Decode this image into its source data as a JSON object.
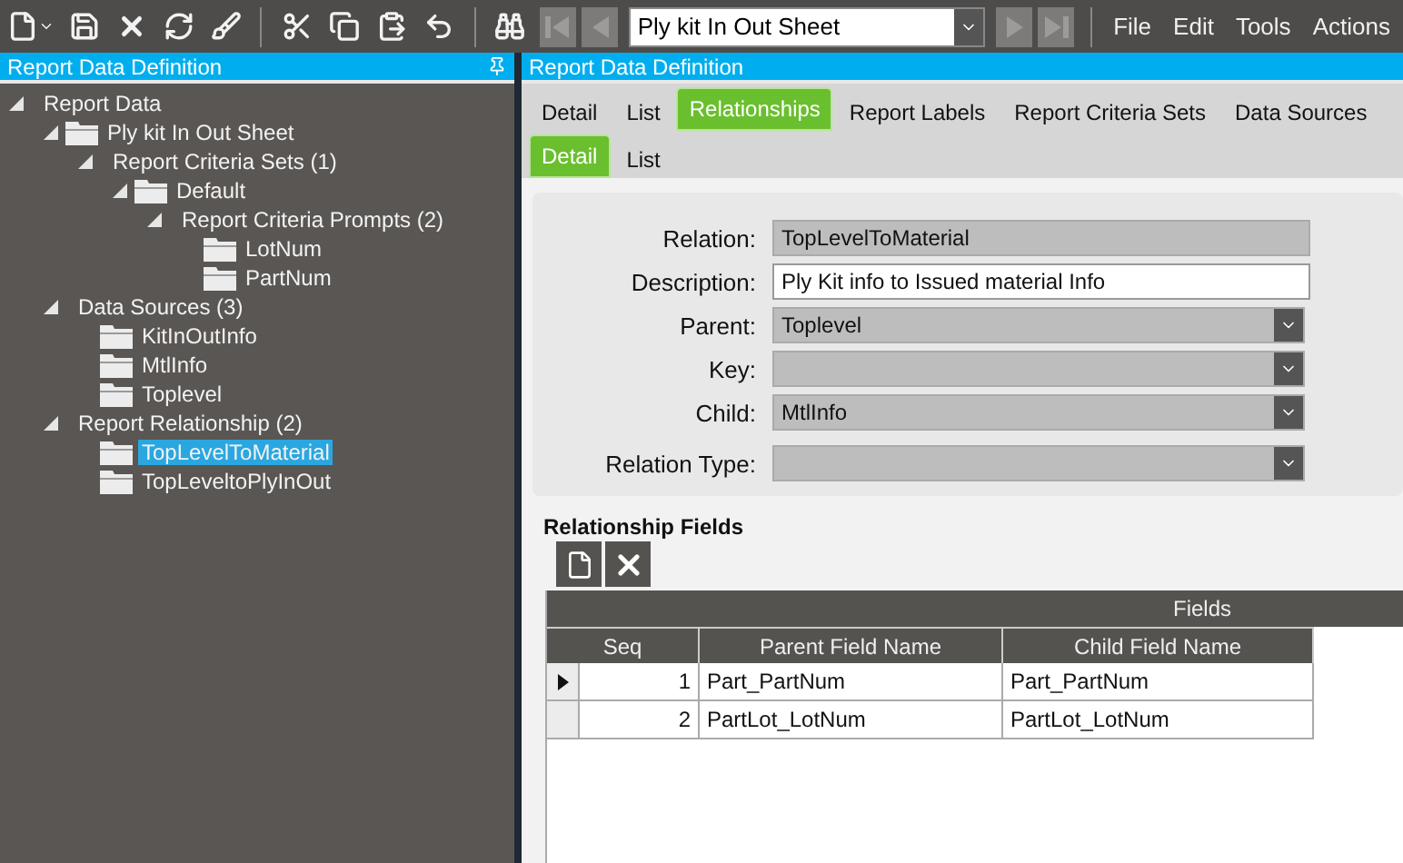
{
  "toolbar": {
    "combo": {
      "value": "Ply kit In Out Sheet"
    },
    "nav": [
      {
        "kind": "first",
        "disabled": true
      },
      {
        "kind": "prev",
        "disabled": true
      }
    ],
    "nav_after": [
      {
        "kind": "next",
        "disabled": true
      },
      {
        "kind": "last",
        "disabled": true
      }
    ],
    "menu": [
      "File",
      "Edit",
      "Tools",
      "Actions"
    ]
  },
  "left_panel": {
    "title": "Report Data Definition",
    "tree": [
      {
        "label": "Report Data",
        "kind": "group",
        "expanded": true,
        "selected": false,
        "children": [
          {
            "label": "Ply kit In Out Sheet",
            "kind": "folder",
            "expanded": true,
            "selected": false,
            "children": [
              {
                "label": "Report Criteria Sets (1)",
                "kind": "group",
                "expanded": true,
                "selected": false,
                "children": [
                  {
                    "label": "Default",
                    "kind": "folder",
                    "expanded": true,
                    "selected": false,
                    "children": [
                      {
                        "label": "Report Criteria Prompts (2)",
                        "kind": "group",
                        "expanded": true,
                        "selected": false,
                        "children": [
                          {
                            "label": "LotNum",
                            "kind": "folder",
                            "selected": false
                          },
                          {
                            "label": "PartNum",
                            "kind": "folder",
                            "selected": false
                          }
                        ]
                      }
                    ]
                  }
                ]
              }
            ]
          },
          {
            "label": "Data Sources (3)",
            "kind": "group",
            "expanded": true,
            "selected": false,
            "children": [
              {
                "label": "KitInOutInfo",
                "kind": "folder",
                "selected": false
              },
              {
                "label": "MtlInfo",
                "kind": "folder",
                "selected": false
              },
              {
                "label": "Toplevel",
                "kind": "folder",
                "selected": false
              }
            ]
          },
          {
            "label": "Report Relationship (2)",
            "kind": "group",
            "expanded": true,
            "selected": false,
            "children": [
              {
                "label": "TopLevelToMaterial",
                "kind": "folder",
                "selected": true
              },
              {
                "label": "TopLeveltoPlyInOut",
                "kind": "folder",
                "selected": false
              }
            ]
          }
        ]
      }
    ]
  },
  "right_panel": {
    "title": "Report Data Definition",
    "tabs": [
      {
        "label": "Detail",
        "selected": false
      },
      {
        "label": "List",
        "selected": false
      },
      {
        "label": "Relationships",
        "selected": true
      },
      {
        "label": "Report Labels",
        "selected": false
      },
      {
        "label": "Report Criteria Sets",
        "selected": false
      },
      {
        "label": "Data Sources",
        "selected": false
      }
    ],
    "subtabs": [
      {
        "label": "Detail",
        "selected": true
      },
      {
        "label": "List",
        "selected": false
      }
    ],
    "form": [
      {
        "label": "Relation:",
        "kind": "readonly",
        "value": "TopLevelToMaterial"
      },
      {
        "label": "Description:",
        "kind": "text",
        "value": "Ply Kit info to Issued material Info"
      },
      {
        "label": "Parent:",
        "kind": "dropdown",
        "value": "Toplevel"
      },
      {
        "label": "Key:",
        "kind": "dropdown"
      },
      {
        "label": "Child:",
        "kind": "dropdown",
        "value": "MtlInfo"
      },
      {
        "label": "Relation Type:",
        "kind": "dropdown"
      }
    ],
    "relationship_fields": {
      "title": "Relationship Fields",
      "group_header": "Fields",
      "columns": [
        "Seq",
        "Parent Field Name",
        "Child Field Name"
      ],
      "rows": [
        {
          "current": true,
          "cells": [
            "1",
            "Part_PartNum",
            "Part_PartNum"
          ]
        },
        {
          "current": false,
          "cells": [
            "2",
            "PartLot_LotNum",
            "PartLot_LotNum"
          ]
        }
      ]
    }
  }
}
